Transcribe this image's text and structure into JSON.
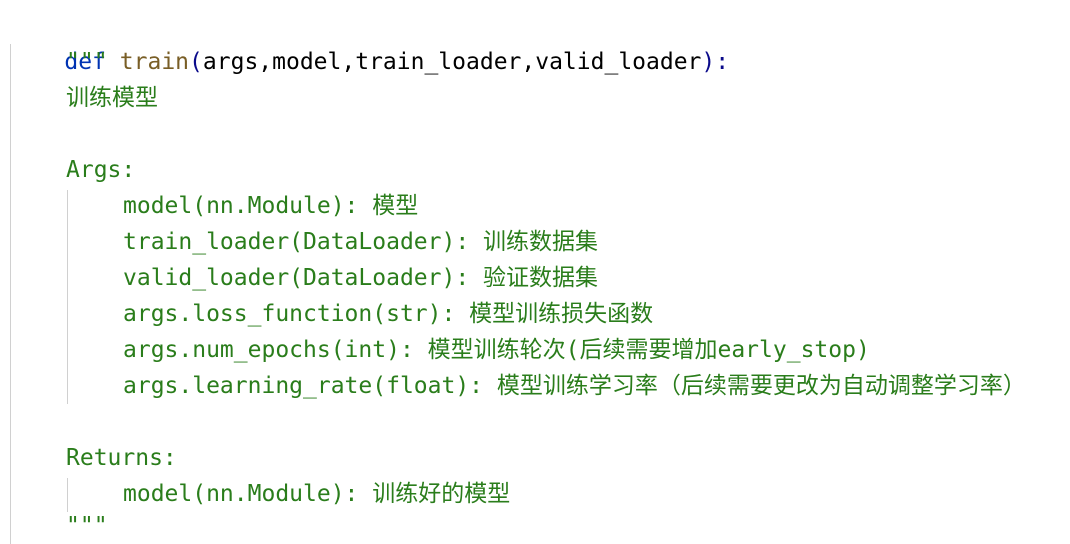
{
  "code": {
    "signature": {
      "keyword": "def",
      "function_name": "train",
      "open_paren": "(",
      "params": "args,model,train_loader,valid_loader",
      "close": "):"
    },
    "docstring": {
      "open_quotes": "\"\"\"",
      "summary": "训练模型",
      "args_header": "Args:",
      "args": [
        "model(nn.Module): 模型",
        "train_loader(DataLoader): 训练数据集",
        "valid_loader(DataLoader): 验证数据集",
        "args.loss_function(str): 模型训练损失函数",
        "args.num_epochs(int): 模型训练轮次(后续需要增加early_stop)",
        "args.learning_rate(float): 模型训练学习率（后续需要更改为自动调整学习率）"
      ],
      "returns_header": "Returns:",
      "returns": [
        "model(nn.Module): 训练好的模型"
      ],
      "close_quotes": "\"\"\""
    }
  }
}
